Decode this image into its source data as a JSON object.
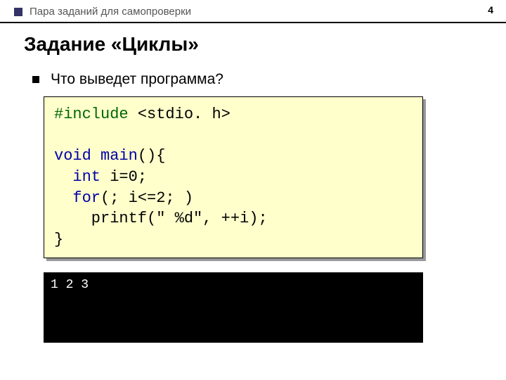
{
  "header": {
    "text": "Пара заданий для самопроверки",
    "page_number": "4"
  },
  "title": "Задание «Циклы»",
  "question": "Что выведет программа?",
  "code": {
    "line1_pp": "#include",
    "line1_rest": " <stdio. h>",
    "line3_kw1": "void",
    "line3_rest1": " ",
    "line3_kw2": "main",
    "line3_rest2": "(){",
    "line4_indent": "  ",
    "line4_kw": "int",
    "line4_rest": " i=0;",
    "line5_indent": "  ",
    "line5_kw": "for",
    "line5_rest": "(; i<=2; )",
    "line6": "    printf(\" %d\", ++i);",
    "line7": "}"
  },
  "output": "1 2 3"
}
